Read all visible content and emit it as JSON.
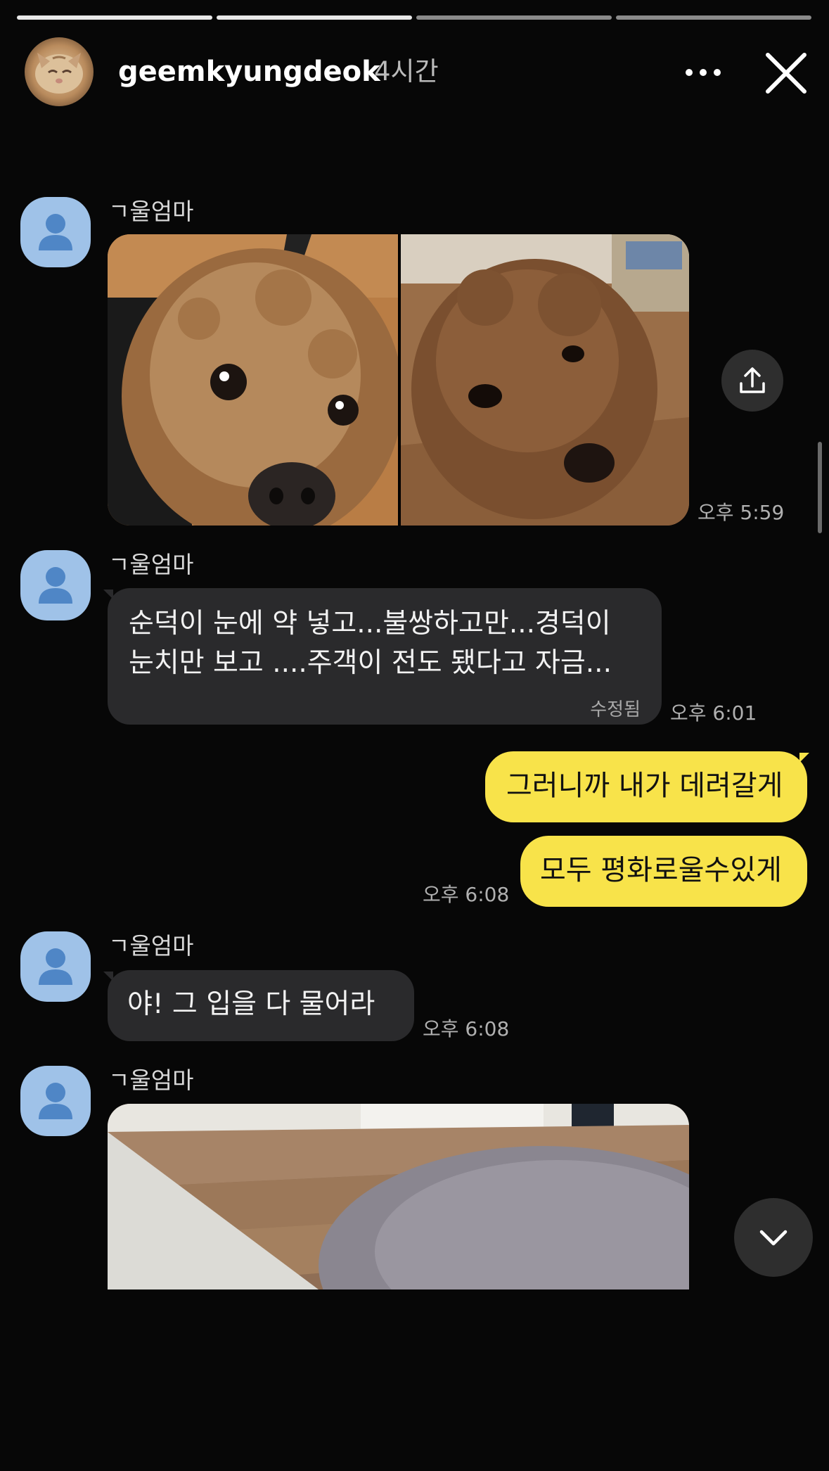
{
  "story": {
    "username": "geemkyungdeok",
    "time_ago": "4시간",
    "progress_segments": [
      1,
      1,
      0.05,
      0
    ]
  },
  "chat": {
    "messages": [
      {
        "type": "photos",
        "sender": "ㄱ울엄마",
        "time": "오후 5:59",
        "images": [
          "poodle-closeup-photo",
          "poodle-floor-photo"
        ]
      },
      {
        "type": "text",
        "sender": "ㄱ울엄마",
        "lines": [
          "순덕이 눈에  약 넣고...불쌍하고만...경덕이",
          "눈치만 보고 ....주객이 전도 됐다고  자금..."
        ],
        "edited_label": "수정됨",
        "time": "오후 6:01"
      },
      {
        "type": "outgoing",
        "text": "그러니까 내가 데려갈게"
      },
      {
        "type": "outgoing",
        "text": "모두 평화로울수있게",
        "time": "오후 6:08"
      },
      {
        "type": "text",
        "sender": "ㄱ울엄마",
        "lines": [
          "야! 그  입을 다 물어라"
        ],
        "time": "오후 6:08"
      },
      {
        "type": "photo",
        "sender": "ㄱ울엄마",
        "images": [
          "gray-cat-photo"
        ]
      }
    ]
  },
  "icons": {
    "more": "more-dots-icon",
    "close": "close-icon",
    "share": "share-icon",
    "scroll_down": "chevron-down-icon",
    "profile": "person-icon"
  },
  "colors": {
    "background": "#070707",
    "incoming_bubble": "#2a2a2c",
    "outgoing_bubble": "#f8e34a",
    "profile_bg": "#9fc2e8"
  }
}
